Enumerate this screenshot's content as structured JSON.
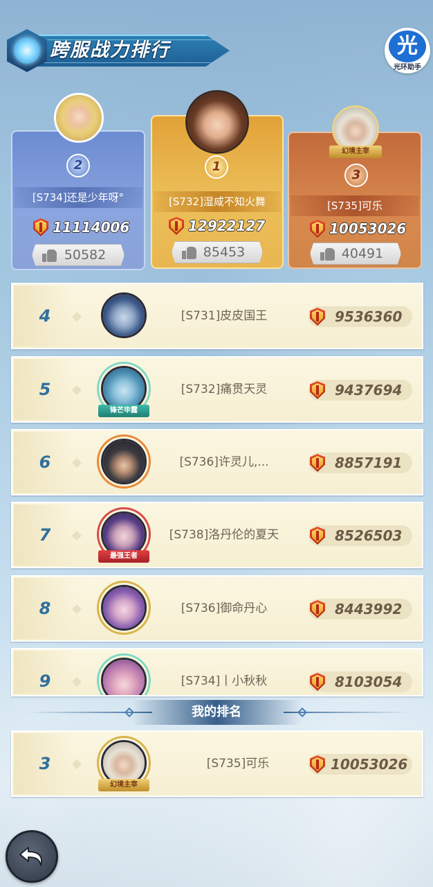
{
  "title": "跨服战力排行",
  "helper_badge": {
    "glyph": "光",
    "label": "光环助手"
  },
  "podium": [
    {
      "rank": "2",
      "name": "[S734]还是少年呀°",
      "power": "11114006",
      "likes": "50582",
      "medal": "silver"
    },
    {
      "rank": "1",
      "name": "[S732]湿咸不知火舞",
      "power": "12922127",
      "likes": "85453",
      "medal": "gold"
    },
    {
      "rank": "3",
      "name": "[S735]可乐",
      "power": "10053026",
      "likes": "40491",
      "medal": "bronze",
      "frame_label": "幻境主宰"
    }
  ],
  "rankings": [
    {
      "rank": "4",
      "name": "[S731]皮皮国王",
      "power": "9536360"
    },
    {
      "rank": "5",
      "name": "[S732]痛贯天灵",
      "power": "9437694",
      "frame_label": "锋芒毕露"
    },
    {
      "rank": "6",
      "name": "[S736]许灵儿,...",
      "power": "8857191"
    },
    {
      "rank": "7",
      "name": "[S738]洛丹伦的夏天",
      "power": "8526503",
      "frame_label": "最强王者"
    },
    {
      "rank": "8",
      "name": "[S736]御命丹心",
      "power": "8443992"
    },
    {
      "rank": "9",
      "name": "[S734]丨小秋秋",
      "power": "8103054"
    }
  ],
  "my_rank": {
    "label": "我的排名",
    "rank": "3",
    "name": "[S735]可乐",
    "power": "10053026",
    "frame_label": "幻境主宰"
  },
  "icons": {
    "power": "shield-sword-icon",
    "likes": "thumbs-up-icon",
    "back": "back-arrow-icon"
  },
  "colors": {
    "silver_card": "#8aa5df",
    "gold_card": "#ecbf59",
    "bronze_card": "#d9894f",
    "row_bg": "#f8f2d8",
    "rank_number": "#2f6f9e"
  }
}
